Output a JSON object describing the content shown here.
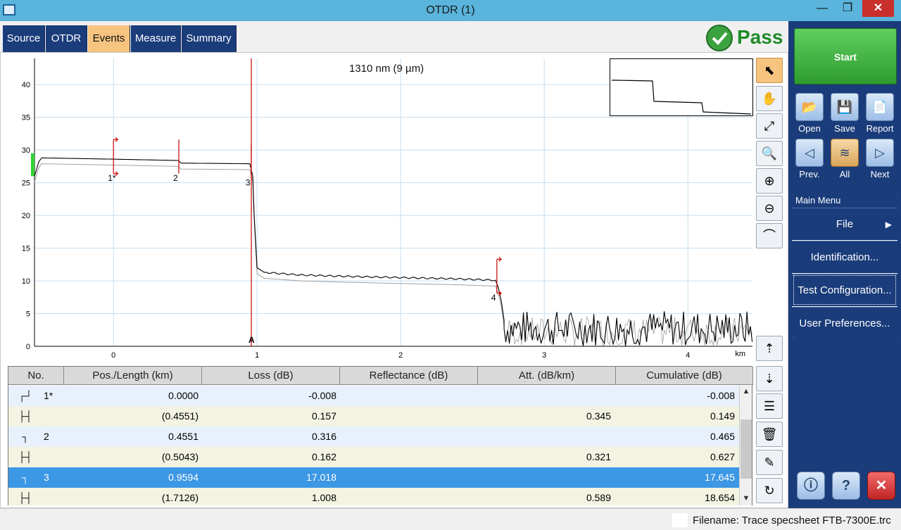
{
  "window": {
    "title": "OTDR (1)",
    "min": "—",
    "max": "❐",
    "close": "✕"
  },
  "tabs": [
    {
      "label": "Source"
    },
    {
      "label": "OTDR"
    },
    {
      "label": "Events"
    },
    {
      "label": "Measure"
    },
    {
      "label": "Summary"
    }
  ],
  "status": {
    "result": "Pass",
    "color": "#1f8a28"
  },
  "graph": {
    "wavelength_label": "1310 nm (9 µm)",
    "marker_label": "A"
  },
  "chart_data": {
    "type": "line",
    "xlabel": "km",
    "ylabel": "",
    "xlim": [
      -0.55,
      4.45
    ],
    "ylim": [
      0,
      44
    ],
    "x_ticks": [
      0,
      1,
      2,
      3,
      4
    ],
    "y_ticks": [
      0,
      5,
      10,
      15,
      20,
      25,
      30,
      35,
      40
    ],
    "series": [
      {
        "x": [
          -0.55,
          -0.52,
          -0.5,
          0.0,
          0.45,
          0.47,
          0.95,
          0.97,
          0.98,
          1.0,
          1.05,
          1.3,
          1.6,
          2.0,
          2.4,
          2.66,
          2.68,
          2.7,
          2.72
        ],
        "values": [
          26,
          28.2,
          28.8,
          28.6,
          28.4,
          28.0,
          27.9,
          26.0,
          20.0,
          12.0,
          11.3,
          10.9,
          10.7,
          10.5,
          10.3,
          10.1,
          9.0,
          7.0,
          4.0
        ],
        "noise_range": [
          2.72,
          4.45
        ],
        "noise_level": [
          0,
          5.5
        ]
      }
    ],
    "events": [
      {
        "label": "1*",
        "x": 0.0
      },
      {
        "label": "2",
        "x": 0.4551
      },
      {
        "label": "3",
        "x": 0.9594
      },
      {
        "label": "4",
        "x": 2.67
      }
    ],
    "marker": {
      "label": "A",
      "x": 0.96
    },
    "colors": {
      "trace": "#000000",
      "marker": "#cc0000",
      "grid": "#c8dff0"
    }
  },
  "tools": [
    "pointer-icon",
    "hand-icon",
    "zoom-fit-icon",
    "zoom-1to1-icon",
    "zoom-in-icon",
    "zoom-out-icon",
    "zoom-area-icon",
    "scroll-up-icon",
    "scroll-down-icon",
    "table-layout-icon",
    "delete-icon",
    "edit-icon",
    "refresh-icon"
  ],
  "table": {
    "headers": [
      "No.",
      "Pos./Length (km)",
      "Loss (dB)",
      "Reflectance (dB)",
      "Att. (dB/km)",
      "Cumulative (dB)"
    ],
    "rows": [
      {
        "icon": "┌┘",
        "no": "1*",
        "pos": "0.0000",
        "loss": "-0.008",
        "refl": "",
        "att": "",
        "cum": "-0.008"
      },
      {
        "icon": "├┤",
        "no": "",
        "pos": "(0.4551)",
        "loss": "0.157",
        "refl": "",
        "att": "0.345",
        "cum": "0.149"
      },
      {
        "icon": "┐",
        "no": "2",
        "pos": "0.4551",
        "loss": "0.316",
        "refl": "",
        "att": "",
        "cum": "0.465"
      },
      {
        "icon": "├┤",
        "no": "",
        "pos": "(0.5043)",
        "loss": "0.162",
        "refl": "",
        "att": "0.321",
        "cum": "0.627"
      },
      {
        "icon": "┐",
        "no": "3",
        "pos": "0.9594",
        "loss": "17.018",
        "refl": "",
        "att": "",
        "cum": "17.645"
      },
      {
        "icon": "├┤",
        "no": "",
        "pos": "(1.7126)",
        "loss": "1.008",
        "refl": "",
        "att": "0.589",
        "cum": "18.654"
      }
    ]
  },
  "side": {
    "start": "Start",
    "open": "Open",
    "save": "Save",
    "report": "Report",
    "prev": "Prev.",
    "all": "All",
    "next": "Next",
    "menu_title": "Main Menu",
    "menu": [
      "File",
      "Identification...",
      "Test Configuration...",
      "User Preferences..."
    ],
    "file_arrow": "▶"
  },
  "footer": {
    "filename": "Filename: Trace specsheet FTB-7300E.trc"
  }
}
